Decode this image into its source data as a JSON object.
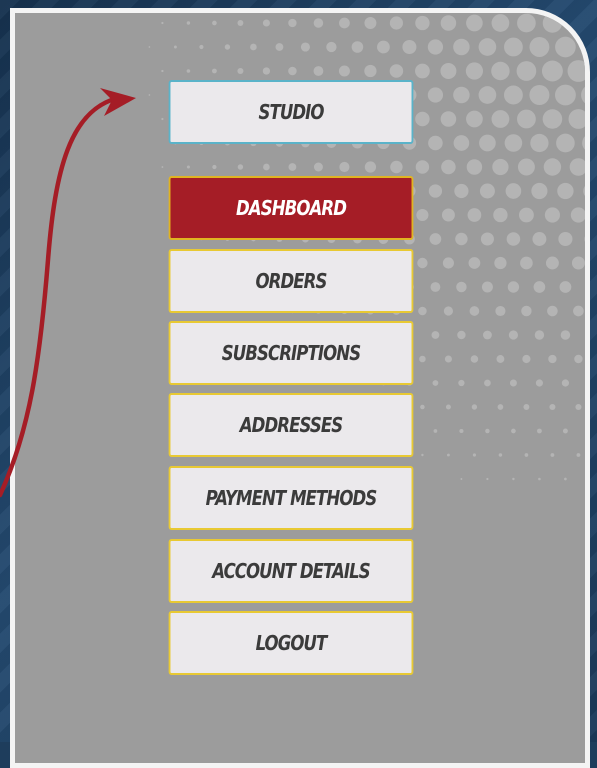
{
  "studio_label": "Studio",
  "menu": [
    {
      "label": "Dashboard",
      "active": true
    },
    {
      "label": "Orders",
      "active": false
    },
    {
      "label": "Subscriptions",
      "active": false
    },
    {
      "label": "Addresses",
      "active": false
    },
    {
      "label": "Payment Methods",
      "active": false
    },
    {
      "label": "Account details",
      "active": false
    },
    {
      "label": "Logout",
      "active": false
    }
  ],
  "colors": {
    "active_bg": "#a51d26",
    "button_bg": "#ebe9ec",
    "button_border": "#e8c933",
    "studio_border": "#5ab3c9",
    "panel_bg": "#9c9c9c",
    "page_bg": "#1e3d5c",
    "arrow": "#a51d26"
  },
  "icons": {
    "arrow": "curved-arrow-icon"
  }
}
